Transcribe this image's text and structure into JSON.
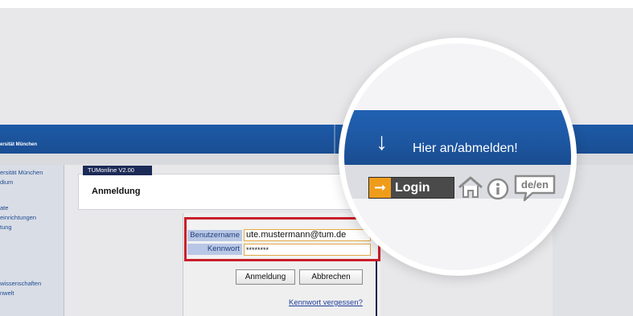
{
  "header": {
    "university": "ersität München"
  },
  "sidebar": {
    "items": [
      {
        "label": "ersität München"
      },
      {
        "label": "dium"
      },
      {
        "label": "ate"
      },
      {
        "label": "einrichtungen"
      },
      {
        "label": "tung"
      },
      {
        "label": "wissenschaften"
      },
      {
        "label": "nwelt"
      }
    ]
  },
  "main": {
    "version_tab": "TUMonline V2.00",
    "title": "Anmeldung"
  },
  "form": {
    "username_label": "Benutzername",
    "username_value": "ute.mustermann@tum.de",
    "password_label": "Kennwort",
    "password_value": "********",
    "submit_label": "Anmeldung",
    "cancel_label": "Abbrechen",
    "forgot_link": "Kennwort vergessen?"
  },
  "magnifier": {
    "hint": "Hier an/abmelden!",
    "login_label": "Login",
    "lang_label": "de/en",
    "icons": [
      "arrow-down-icon",
      "arrow-right-icon",
      "home-icon",
      "info-icon",
      "language-switch-icon"
    ]
  },
  "colors": {
    "header_blue": "#1d5aa6",
    "highlight_red": "#c8202a",
    "login_orange": "#ef9c1a",
    "nav_navy": "#1c2a57"
  }
}
